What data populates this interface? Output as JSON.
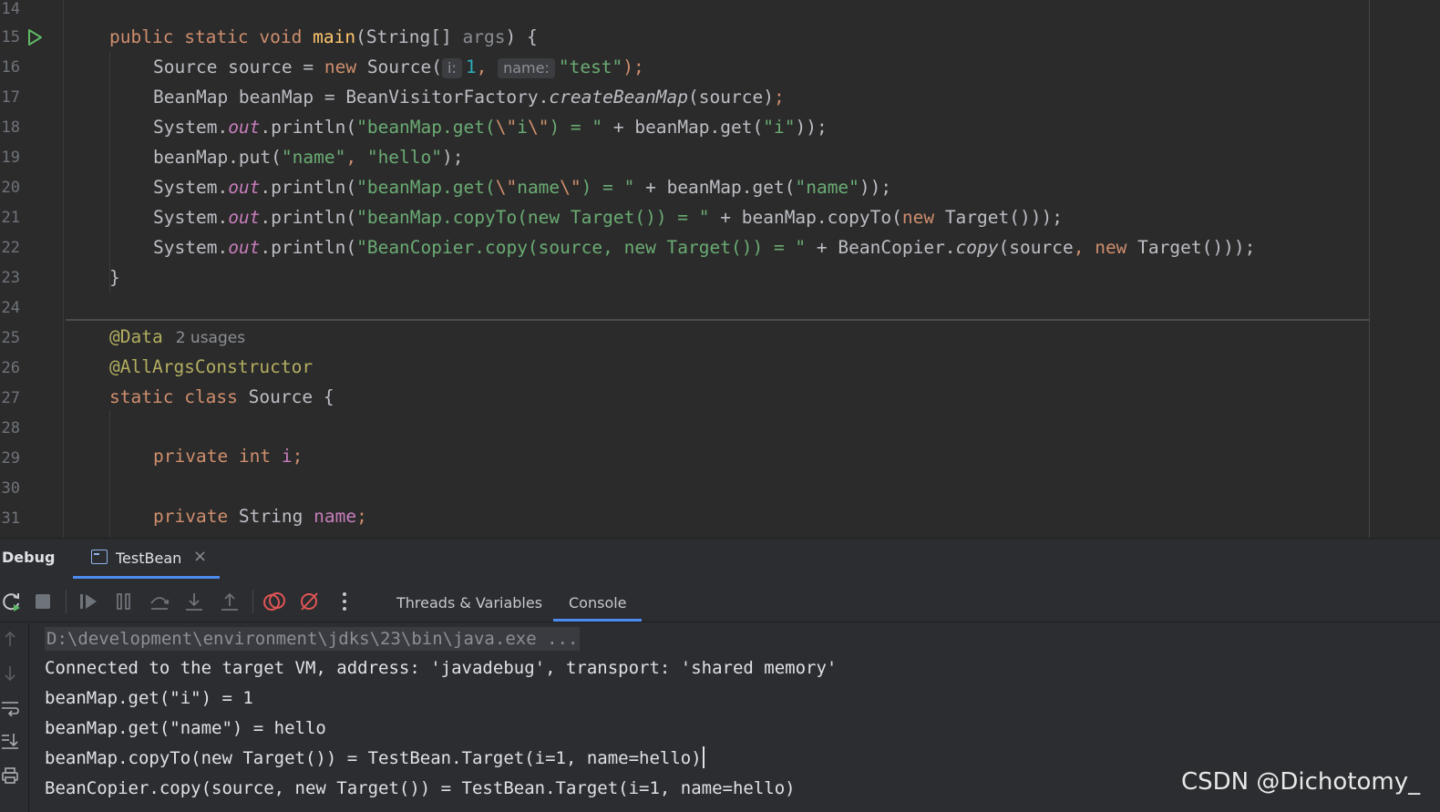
{
  "editor": {
    "line_numbers": [
      "14",
      "15",
      "16",
      "17",
      "18",
      "19",
      "20",
      "21",
      "22",
      "23",
      "24",
      "25",
      "26",
      "27",
      "28",
      "29",
      "30",
      "31"
    ],
    "code": {
      "l15": {
        "public": "public",
        "static": "static",
        "void": "void",
        "method": "main",
        "params": "(String[] ",
        "args": "args",
        "open": ") {"
      },
      "l16": {
        "a": "Source source = ",
        "new": "new",
        "b": " Source(",
        "hint_i": "i:",
        "num": "1",
        "comma": ", ",
        "hint_name": "name:",
        "str": "\"test\"",
        "close": ");"
      },
      "l17": {
        "a": "BeanMap beanMap = BeanVisitorFactory.",
        "call": "createBeanMap",
        "b": "(source)",
        "semi": ";"
      },
      "l18": {
        "a": "System.",
        "out": "out",
        "b": ".println(",
        "s1": "\"beanMap.get(",
        "esc1": "\\\"",
        "s2": "i",
        "esc2": "\\\"",
        "s3": ") = \"",
        "c": " + beanMap.get(",
        "s4": "\"i\"",
        "d": "));"
      },
      "l19": {
        "a": "beanMap.put(",
        "s1": "\"name\"",
        "comma": ", ",
        "s2": "\"hello\"",
        "b": ");"
      },
      "l20": {
        "a": "System.",
        "out": "out",
        "b": ".println(",
        "s1": "\"beanMap.get(",
        "esc1": "\\\"",
        "s2": "name",
        "esc2": "\\\"",
        "s3": ") = \"",
        "c": " + beanMap.get(",
        "s4": "\"name\"",
        "d": "));"
      },
      "l21": {
        "a": "System.",
        "out": "out",
        "b": ".println(",
        "s1": "\"beanMap.copyTo(new Target()) = \"",
        "c": " + beanMap.copyTo(",
        "new": "new",
        "d": " Target()));"
      },
      "l22": {
        "a": "System.",
        "out": "out",
        "b": ".println(",
        "s1": "\"BeanCopier.copy(source, new Target()) = \"",
        "c": " + BeanCopier.",
        "call": "copy",
        "d": "(source",
        "comma": ", ",
        "new": "new",
        "e": " Target()));"
      },
      "l23": {
        "brace": "}"
      },
      "l25": {
        "ann": "@Data",
        "usages": "2 usages"
      },
      "l26": {
        "ann": "@AllArgsConstructor"
      },
      "l27": {
        "static": "static",
        "class": "class",
        "name": " Source {"
      },
      "l29": {
        "private": "private",
        "int": "int",
        "field": "i",
        "semi": ";"
      },
      "l31": {
        "private": "private",
        "type": " String ",
        "field": "name",
        "semi": ";"
      }
    }
  },
  "debug": {
    "title": "Debug",
    "tab_label": "TestBean",
    "tab_close": "×",
    "sub_tabs": {
      "threads": "Threads & Variables",
      "console": "Console"
    },
    "console_lines": [
      "D:\\development\\environment\\jdks\\23\\bin\\java.exe ...",
      "Connected to the target VM, address: 'javadebug', transport: 'shared memory'",
      "beanMap.get(\"i\") = 1",
      "beanMap.get(\"name\") = hello",
      "beanMap.copyTo(new Target()) = TestBean.Target(i=1, name=hello)",
      "BeanCopier.copy(source, new Target()) = TestBean.Target(i=1, name=hello)"
    ]
  },
  "watermark": "CSDN @Dichotomy_",
  "icons": [
    "run-gutter-icon",
    "rerun-icon",
    "stop-icon",
    "resume-icon",
    "pause-icon",
    "step-over-icon",
    "step-into-icon",
    "step-out-icon",
    "view-breakpoints-icon",
    "mute-breakpoints-icon",
    "more-icon",
    "scroll-up-icon",
    "scroll-down-icon",
    "soft-wrap-icon",
    "scroll-to-end-icon",
    "print-icon"
  ],
  "colors": {
    "keyword": "#cf8e6d",
    "string": "#6aab73",
    "number": "#2aacb8",
    "field": "#c77dbb",
    "annotation": "#b3ae60",
    "method": "#ffc66d",
    "accent": "#4c8cf0"
  }
}
